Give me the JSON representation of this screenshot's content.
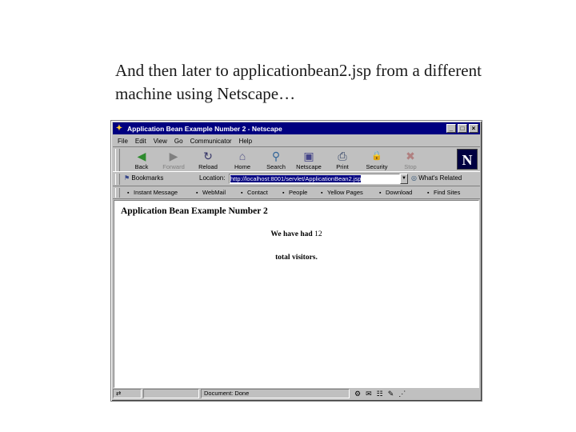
{
  "slide": {
    "caption_line1": "And then later to applicationbean2.jsp from a different",
    "caption_line2": "machine using Netscape…"
  },
  "window": {
    "title": "Application Bean Example Number 2 - Netscape",
    "controls": {
      "minimize": "_",
      "maximize": "□",
      "close": "×"
    }
  },
  "menu": [
    "File",
    "Edit",
    "View",
    "Go",
    "Communicator",
    "Help"
  ],
  "toolbar": {
    "buttons": [
      {
        "label": "Back",
        "icon": "back-arrow-icon",
        "glyph": "◀"
      },
      {
        "label": "Forward",
        "icon": "forward-arrow-icon",
        "glyph": "▶"
      },
      {
        "label": "Reload",
        "icon": "reload-icon",
        "glyph": "↻"
      },
      {
        "label": "Home",
        "icon": "home-icon",
        "glyph": "⌂"
      },
      {
        "label": "Search",
        "icon": "search-icon",
        "glyph": "⚲"
      },
      {
        "label": "Netscape",
        "icon": "netscape-icon",
        "glyph": "▣"
      },
      {
        "label": "Print",
        "icon": "print-icon",
        "glyph": "⎙"
      },
      {
        "label": "Security",
        "icon": "lock-icon",
        "glyph": "🔒"
      },
      {
        "label": "Stop",
        "icon": "stop-icon",
        "glyph": "✖"
      }
    ],
    "logo": "N"
  },
  "location": {
    "bookmarks_label": "Bookmarks",
    "location_label": "Location:",
    "url": "http://localhost:8001/servlet/ApplicationBean2.jsp",
    "whats_related": "What's Related"
  },
  "personal_toolbar": [
    "Instant Message",
    "WebMail",
    "Contact",
    "People",
    "Yellow Pages",
    "Download",
    "Find Sites"
  ],
  "page": {
    "heading": "Application Bean Example Number 2",
    "visitors_prefix": "We have had",
    "visitor_count": "12",
    "visitors_suffix": "total visitors."
  },
  "status": {
    "text": "Document: Done"
  },
  "colors": {
    "titlebar": "#000080",
    "chrome": "#c0c0c0"
  }
}
